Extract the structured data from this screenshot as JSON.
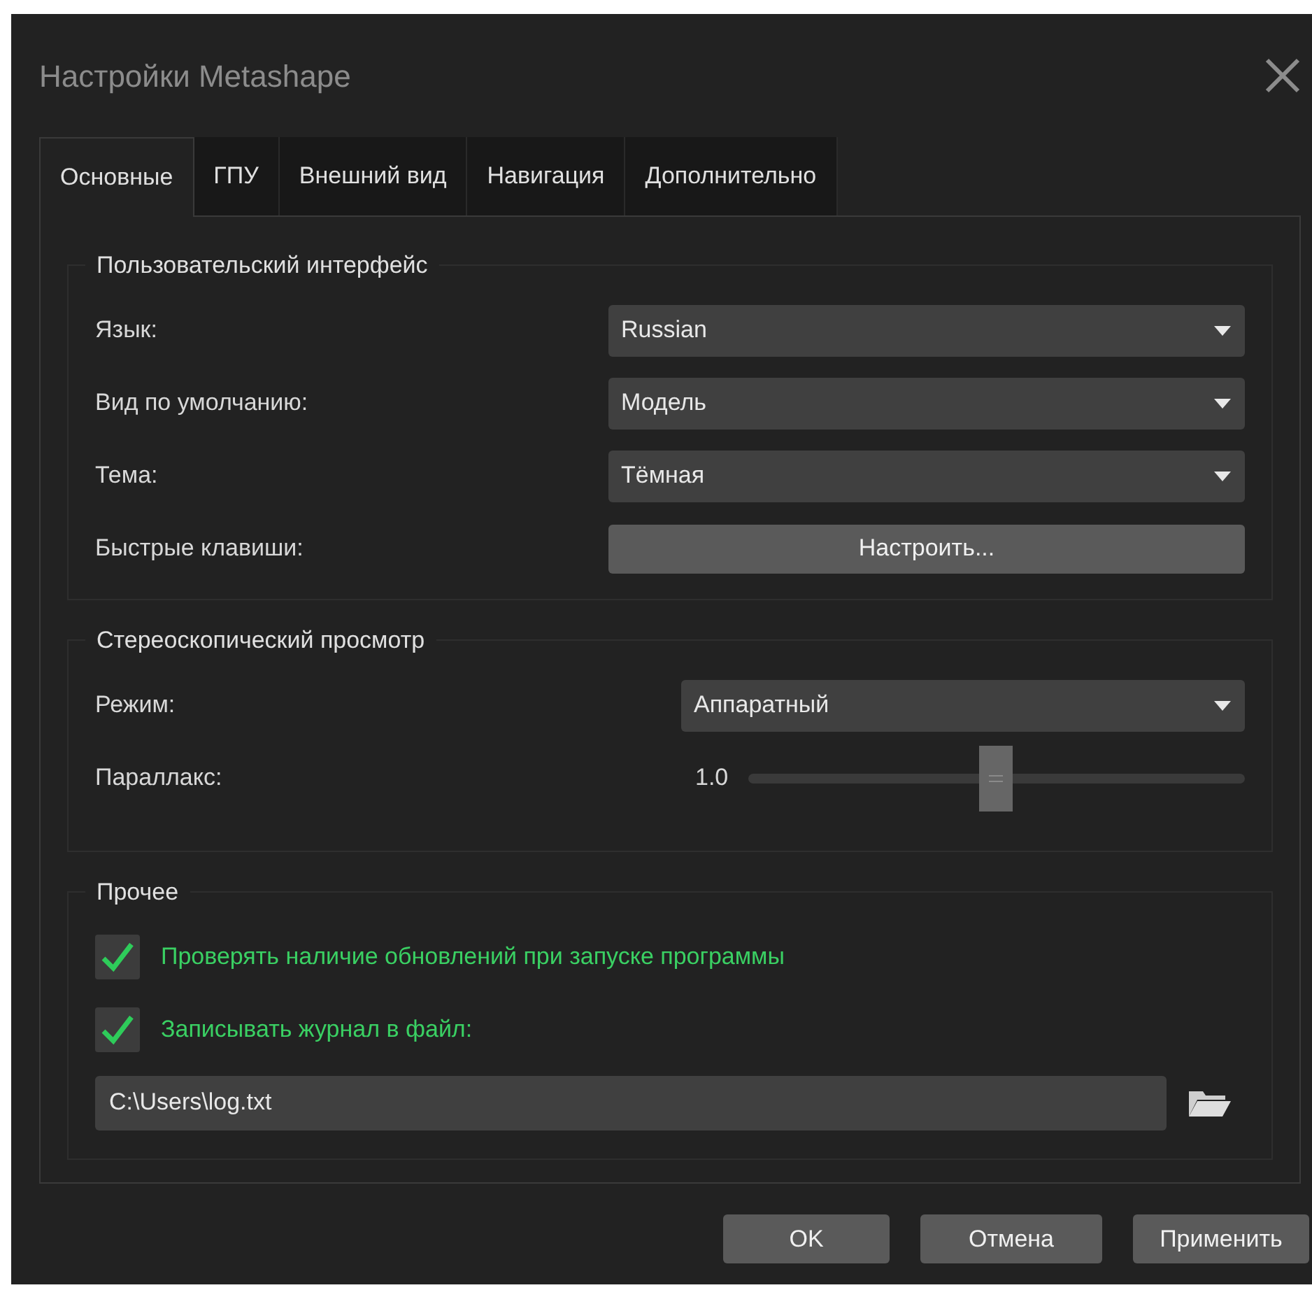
{
  "window": {
    "title": "Настройки Metashape"
  },
  "tabs": [
    {
      "label": "Основные",
      "selected": true
    },
    {
      "label": "ГПУ",
      "selected": false
    },
    {
      "label": "Внешний вид",
      "selected": false
    },
    {
      "label": "Навигация",
      "selected": false
    },
    {
      "label": "Дополнительно",
      "selected": false
    }
  ],
  "groups": [
    {
      "title": "Пользовательский интерфейс",
      "rows": [
        {
          "kind": "dropdown",
          "label": "Язык:",
          "value": "Russian"
        },
        {
          "kind": "dropdown",
          "label": "Вид по умолчанию:",
          "value": "Модель"
        },
        {
          "kind": "dropdown",
          "label": "Тема:",
          "value": "Тёмная"
        },
        {
          "kind": "button",
          "label": "Быстрые клавиши:",
          "value": "Настроить..."
        }
      ]
    },
    {
      "title": "Стереоскопический просмотр",
      "rows": [
        {
          "kind": "dropdown",
          "label": "Режим:",
          "value": "Аппаратный"
        },
        {
          "kind": "slider",
          "label": "Параллакс:",
          "value": "1.0",
          "level": 0.5
        }
      ]
    },
    {
      "title": "Прочее",
      "rows": [
        {
          "kind": "checkbox",
          "label": "Проверять наличие обновлений при запуске программы",
          "checked": true
        },
        {
          "kind": "checkbox",
          "label": "Записывать журнал в файл:",
          "checked": true
        },
        {
          "kind": "path",
          "value": "C:\\Users\\log.txt"
        }
      ]
    }
  ],
  "buttons": [
    "OK",
    "Отмена",
    "Применить"
  ]
}
